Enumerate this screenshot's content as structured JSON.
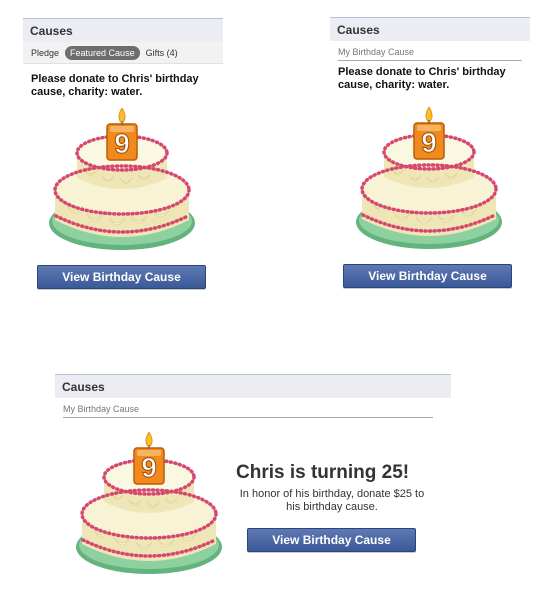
{
  "panel1": {
    "header": "Causes",
    "tabs": [
      "Pledge",
      "Featured Cause",
      "Gifts (4)"
    ],
    "message": "Please donate to Chris' birthday cause, charity: water.",
    "button": "View Birthday Cause",
    "candle_digit": "9"
  },
  "panel2": {
    "header": "Causes",
    "subheader": "My Birthday Cause",
    "message": "Please donate to Chris' birthday cause, charity: water.",
    "button": "View Birthday Cause",
    "candle_digit": "9"
  },
  "panel3": {
    "header": "Causes",
    "subheader": "My Birthday Cause",
    "title": "Chris is turning 25!",
    "body": "In honor of his birthday, donate $25 to his birthday cause.",
    "button": "View Birthday Cause",
    "candle_digit": "9"
  },
  "colors": {
    "header_bg": "#ecedf3",
    "header_border": "#b9c1d7",
    "button_bg": "#3b5998",
    "candle": "#f08a1c",
    "plate": "#63b37d",
    "cake": "#f4efc7",
    "beads": "#d6476f"
  },
  "icons": [
    "birthday-cake-icon",
    "candle-icon",
    "flame-icon"
  ]
}
